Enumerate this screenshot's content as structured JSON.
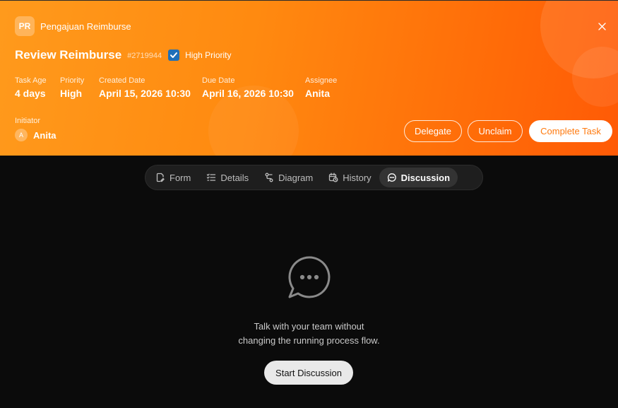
{
  "header": {
    "app_badge": "PR",
    "app_name": "Pengajuan Reimburse",
    "title": "Review Reimburse",
    "task_id": "#2719944",
    "high_priority": {
      "checked": true,
      "label": "High Priority"
    },
    "meta": [
      {
        "label": "Task Age",
        "value": "4 days"
      },
      {
        "label": "Priority",
        "value": "High"
      },
      {
        "label": "Created Date",
        "value": "April 15, 2026 10:30"
      },
      {
        "label": "Due Date",
        "value": "April 16, 2026 10:30"
      },
      {
        "label": "Assignee",
        "value": "Anita"
      }
    ],
    "initiator": {
      "label": "Initiator",
      "avatar": "A",
      "name": "Anita"
    },
    "actions": {
      "delegate": "Delegate",
      "unclaim": "Unclaim",
      "complete": "Complete Task"
    },
    "gradient": [
      "#ff9a1c",
      "#ff5a06"
    ]
  },
  "tabs": [
    {
      "label": "Form",
      "icon": "form-icon",
      "active": false
    },
    {
      "label": "Details",
      "icon": "checklist-icon",
      "active": false
    },
    {
      "label": "Diagram",
      "icon": "diagram-icon",
      "active": false
    },
    {
      "label": "History",
      "icon": "history-icon",
      "active": false
    },
    {
      "label": "Discussion",
      "icon": "chat-icon",
      "active": true
    }
  ],
  "discussion": {
    "icon": "chat-bubble-icon",
    "message_line1": "Talk with your team without",
    "message_line2": "changing the running process flow.",
    "start_button": "Start Discussion"
  },
  "colors": {
    "accent": "#ff7a0f",
    "background": "#0b0b0b",
    "checkbox": "#1f6fb8"
  }
}
